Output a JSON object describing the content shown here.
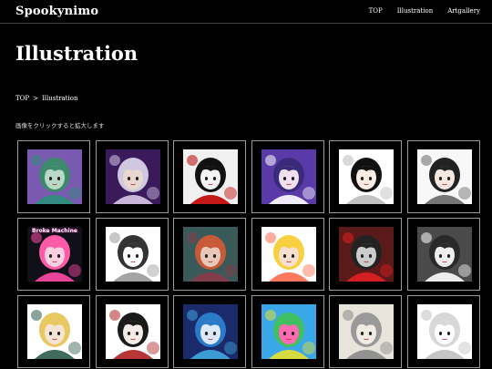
{
  "header": {
    "brand": "Spookynimo",
    "nav": [
      "TOP",
      "Illustration",
      "Artgallery"
    ]
  },
  "page": {
    "title": "Illustration",
    "breadcrumb": [
      "TOP",
      "Illustration"
    ],
    "hint": "画像をクリックすると拡大します"
  },
  "gallery": {
    "rows": [
      [
        {
          "name": "green-hair-girl",
          "bg": "#7a5ab0",
          "accent": "#2e8f7a",
          "skin": "#b8d8c8",
          "hair": "#3f8a6e"
        },
        {
          "name": "white-hair-girl",
          "bg": "#3a1a5a",
          "accent": "#d8c8e8",
          "skin": "#e8d8d0",
          "hair": "#d0c8e0"
        },
        {
          "name": "black-hair-girl-red-lips",
          "bg": "#f0f0f0",
          "accent": "#c00000",
          "skin": "#f4f4f4",
          "hair": "#111111"
        },
        {
          "name": "purple-floral-girl",
          "bg": "#5a3aa8",
          "accent": "#ffffff",
          "skin": "#f0e0f0",
          "hair": "#3a2a7a"
        },
        {
          "name": "boy-sketch",
          "bg": "#ffffff",
          "accent": "#bbbbbb",
          "skin": "#f8ece4",
          "hair": "#111111"
        },
        {
          "name": "dark-hair-boy",
          "bg": "#f8f8f8",
          "accent": "#666666",
          "skin": "#f4e8e0",
          "hair": "#222222"
        }
      ],
      [
        {
          "name": "broke-machine",
          "bg": "#101018",
          "accent": "#ff4aa8",
          "skin": "#f8d0e0",
          "hair": "#ff5aa8",
          "label": "Broke Machine"
        },
        {
          "name": "pencil-boy",
          "bg": "#ffffff",
          "accent": "#999999",
          "skin": "#ffffff",
          "hair": "#333333"
        },
        {
          "name": "teal-bg-boy",
          "bg": "#3a5a5a",
          "accent": "#8a3a4a",
          "skin": "#e8c8b8",
          "hair": "#c85a3a"
        },
        {
          "name": "blonde-twintail-girl",
          "bg": "#ffffff",
          "accent": "#ff6a4a",
          "skin": "#f8e0d0",
          "hair": "#f8d040"
        },
        {
          "name": "red-poster",
          "bg": "#5a1a1a",
          "accent": "#e02020",
          "skin": "#cccccc",
          "hair": "#222222"
        },
        {
          "name": "ghost-sketch",
          "bg": "#4a4a4a",
          "accent": "#ffffff",
          "skin": "#eeeeee",
          "hair": "#2a2a2a"
        }
      ],
      [
        {
          "name": "blonde-boy-green-jacket",
          "bg": "#ffffff",
          "accent": "#2a5a4a",
          "skin": "#f4e4d4",
          "hair": "#e8c860"
        },
        {
          "name": "dark-hair-girl-black",
          "bg": "#ffffff",
          "accent": "#b02020",
          "skin": "#f4ece8",
          "hair": "#1a1a1a"
        },
        {
          "name": "blue-hair-girl",
          "bg": "#1a2a6a",
          "accent": "#40a8e0",
          "skin": "#dce8f8",
          "hair": "#2a7ac8"
        },
        {
          "name": "colorful-collage",
          "bg": "#3aa8e8",
          "accent": "#e8e030",
          "skin": "#ff6ab0",
          "hair": "#40c060"
        },
        {
          "name": "sketch-sheet",
          "bg": "#e8e4dc",
          "accent": "#888888",
          "skin": "#f0ece4",
          "hair": "#999999"
        },
        {
          "name": "pale-sketch-girl",
          "bg": "#ffffff",
          "accent": "#c0c0c0",
          "skin": "#ffffff",
          "hair": "#d8d8d8"
        }
      ]
    ]
  }
}
